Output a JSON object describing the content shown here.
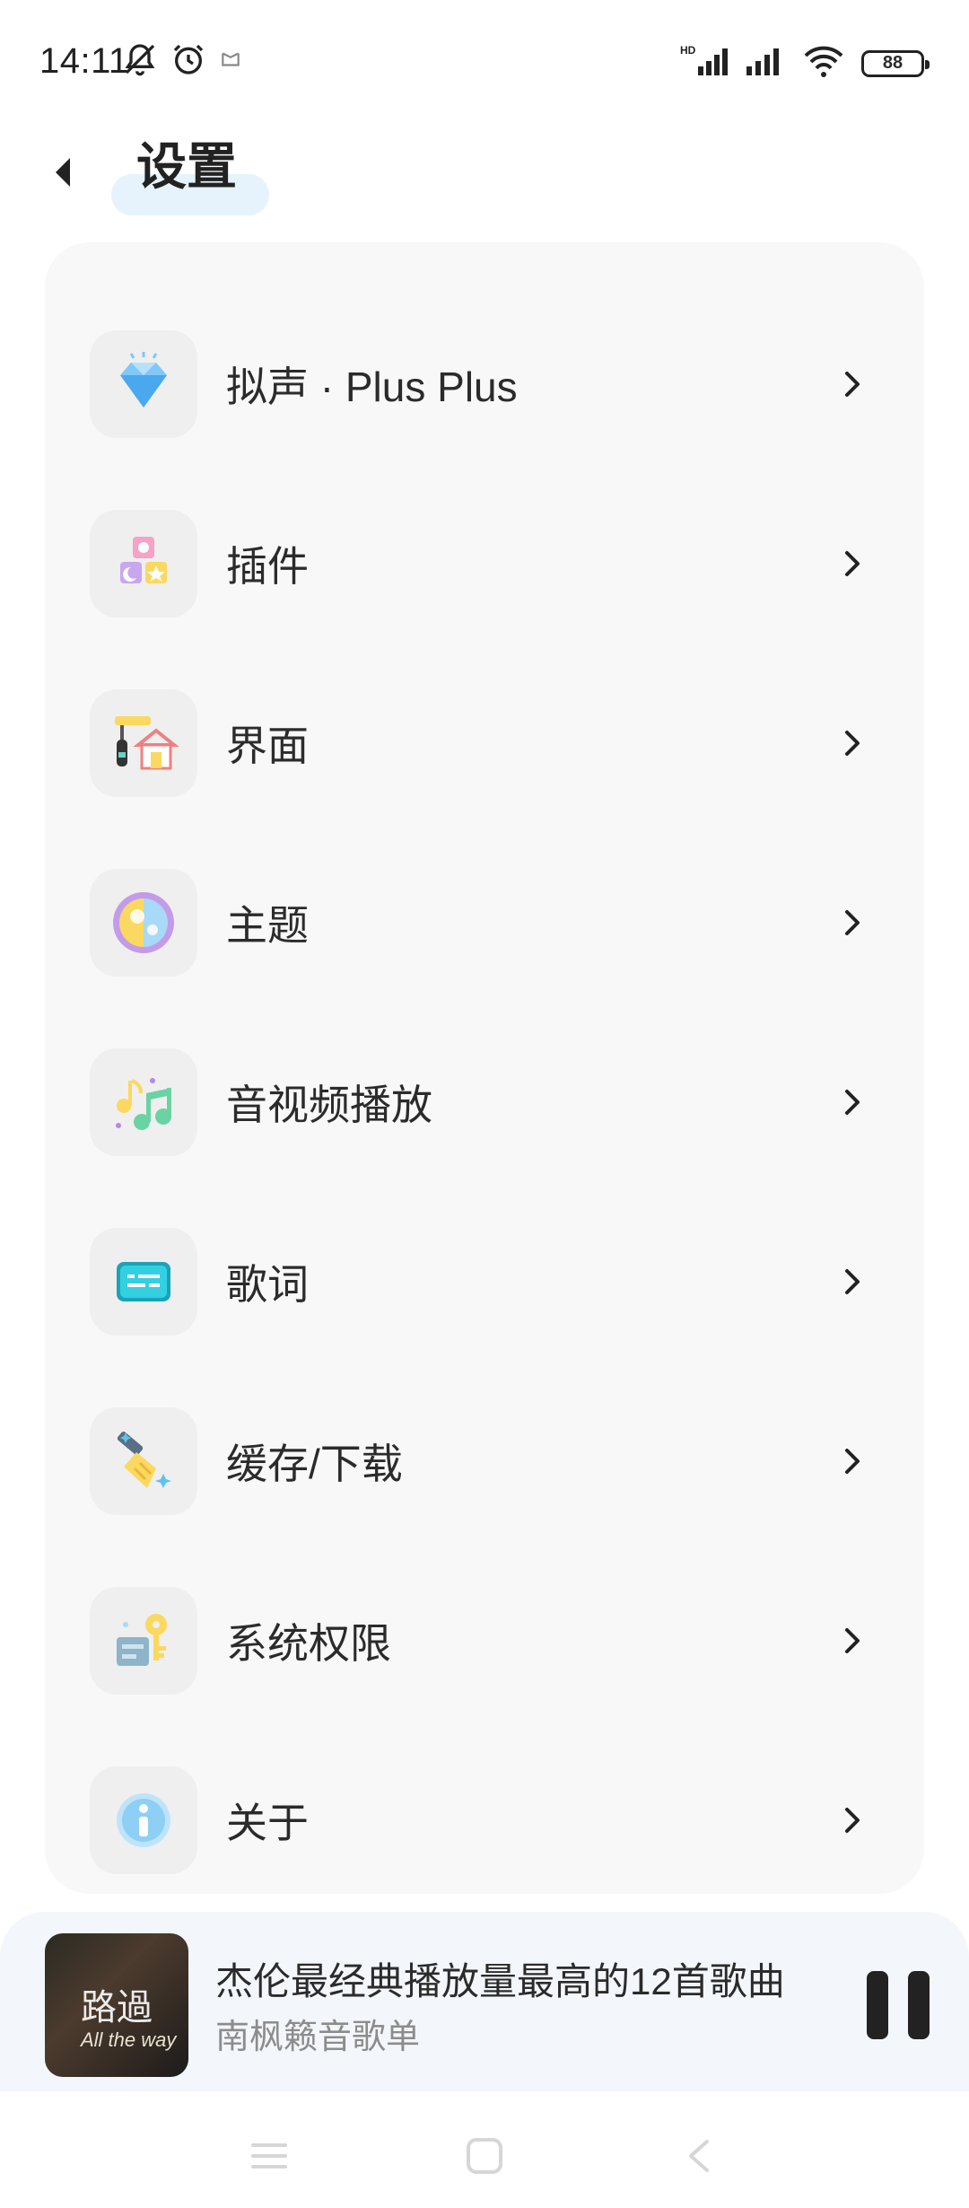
{
  "status_bar": {
    "time": "14:11",
    "battery": "88",
    "icons": [
      "mute-icon",
      "alarm-icon",
      "notification-icon",
      "hd-signal-icon",
      "signal-icon",
      "wifi-icon",
      "battery-icon"
    ]
  },
  "header": {
    "title": "设置",
    "back_icon": "back-arrow-icon",
    "accent_color": "#e6f3fc"
  },
  "settings": {
    "items": [
      {
        "label": "拟声 · Plus Plus",
        "icon": "diamond-icon"
      },
      {
        "label": "插件",
        "icon": "blocks-icon"
      },
      {
        "label": "界面",
        "icon": "paint-house-icon"
      },
      {
        "label": "主题",
        "icon": "theme-icon"
      },
      {
        "label": "音视频播放",
        "icon": "music-note-icon"
      },
      {
        "label": "歌词",
        "icon": "lyrics-icon"
      },
      {
        "label": "缓存/下载",
        "icon": "broom-icon"
      },
      {
        "label": "系统权限",
        "icon": "key-icon"
      },
      {
        "label": "关于",
        "icon": "info-icon"
      }
    ]
  },
  "player": {
    "song_title": "杰伦最经典播放量最高的12首歌曲",
    "artist": "南枫籁音歌单",
    "cover_text": "路過",
    "cover_sub": "All the way"
  },
  "nav_bar": {
    "items": [
      "menu-icon",
      "home-icon",
      "back-icon"
    ]
  }
}
